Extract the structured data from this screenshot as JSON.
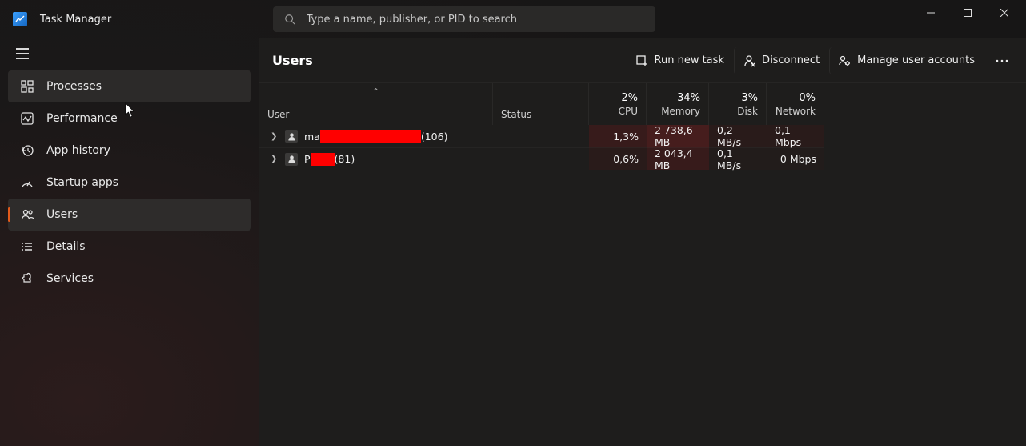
{
  "app": {
    "title": "Task Manager"
  },
  "search": {
    "placeholder": "Type a name, publisher, or PID to search"
  },
  "sidebar": {
    "items": [
      {
        "label": "Processes"
      },
      {
        "label": "Performance"
      },
      {
        "label": "App history"
      },
      {
        "label": "Startup apps"
      },
      {
        "label": "Users"
      },
      {
        "label": "Details"
      },
      {
        "label": "Services"
      }
    ]
  },
  "toolbar": {
    "heading": "Users",
    "run_new_task": "Run new task",
    "disconnect": "Disconnect",
    "manage_user_accounts": "Manage user accounts"
  },
  "columns": {
    "user": "User",
    "status": "Status",
    "cpu": {
      "value": "2%",
      "label": "CPU"
    },
    "memory": {
      "value": "34%",
      "label": "Memory"
    },
    "disk": {
      "value": "3%",
      "label": "Disk"
    },
    "network": {
      "value": "0%",
      "label": "Network"
    }
  },
  "rows": [
    {
      "name_prefix": "ma",
      "name_suffix": " (106)",
      "status": "",
      "cpu": "1,3%",
      "memory": "2 738,6 MB",
      "disk": "0,2 MB/s",
      "network": "0,1 Mbps"
    },
    {
      "name_prefix": "P",
      "name_suffix": "(81)",
      "status": "",
      "cpu": "0,6%",
      "memory": "2 043,4 MB",
      "disk": "0,1 MB/s",
      "network": "0 Mbps"
    }
  ]
}
